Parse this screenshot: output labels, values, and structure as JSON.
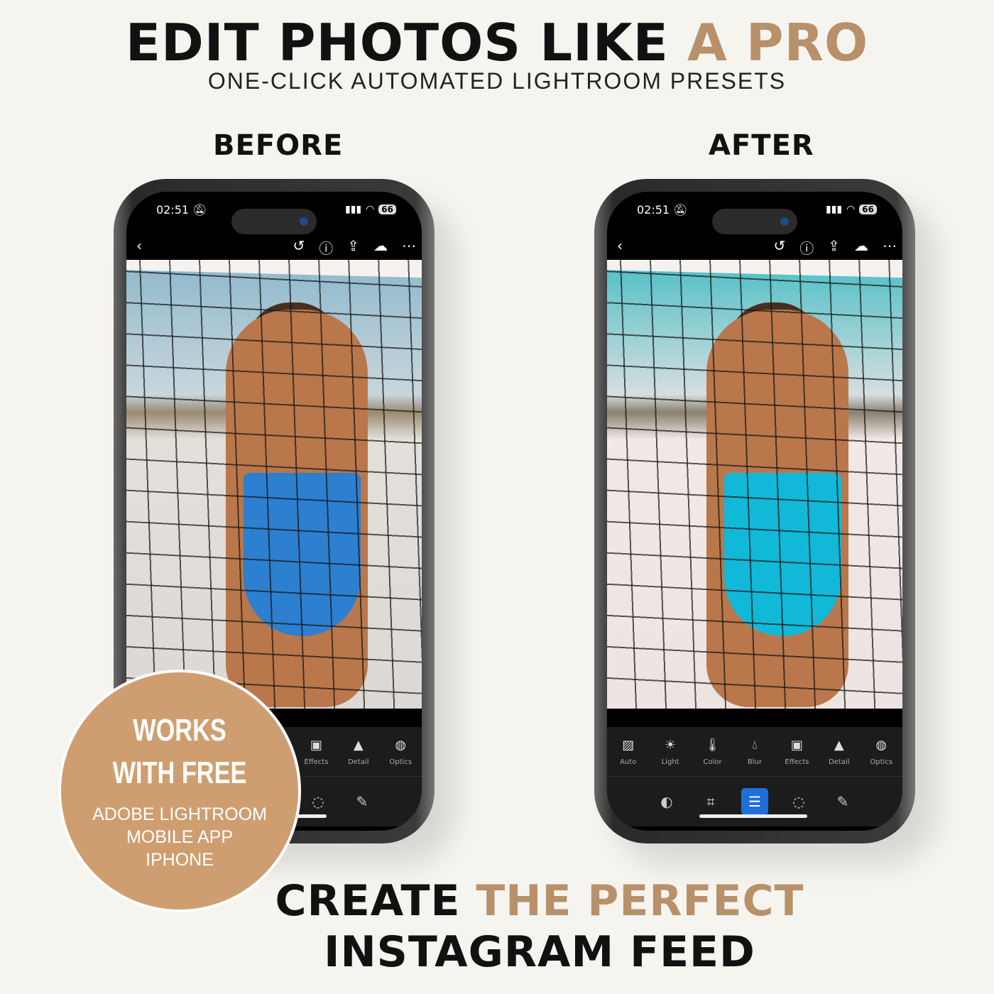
{
  "header": {
    "title_main": "EDIT PHOTOS LIKE",
    "title_accent": "A PRO",
    "subtitle": "ONE-CLICK AUTOMATED LIGHTROOM PRESETS"
  },
  "labels": {
    "before": "BEFORE",
    "after": "AFTER"
  },
  "colors": {
    "accent": "#b8916a",
    "badge": "#cf9e70",
    "background": "#f6f4ef",
    "active_tool": "#1e6fd9"
  },
  "phone": {
    "time": "02:51",
    "battery": "66",
    "status_icons": [
      "bell-slash-icon",
      "signal-icon",
      "wifi-icon",
      "battery-icon"
    ],
    "top_icons": [
      "back-icon",
      "history-icon",
      "help-icon",
      "share-icon",
      "cloud-synced-icon",
      "more-icon"
    ],
    "tools": [
      {
        "label": "Auto",
        "icon": "auto-icon"
      },
      {
        "label": "Light",
        "icon": "sun-icon"
      },
      {
        "label": "Color",
        "icon": "thermometer-icon"
      },
      {
        "label": "Blur",
        "icon": "drop-icon"
      },
      {
        "label": "Effects",
        "icon": "vignette-icon"
      },
      {
        "label": "Detail",
        "icon": "triangle-icon"
      },
      {
        "label": "Optics",
        "icon": "lens-icon"
      }
    ],
    "bottom_tools": [
      "presets-icon",
      "crop-icon",
      "edit-sliders-icon",
      "masking-icon",
      "healing-icon"
    ],
    "active_bottom_tool": "edit-sliders-icon"
  },
  "badge": {
    "line1": "WORKS",
    "line2": "WITH FREE",
    "line3": "ADOBE LIGHTROOM",
    "line4": "MOBILE APP",
    "line5": "IPHONE"
  },
  "footer": {
    "line1_main": "CREATE",
    "line1_accent": "THE PERFECT",
    "line2": "INSTAGRAM FEED"
  }
}
